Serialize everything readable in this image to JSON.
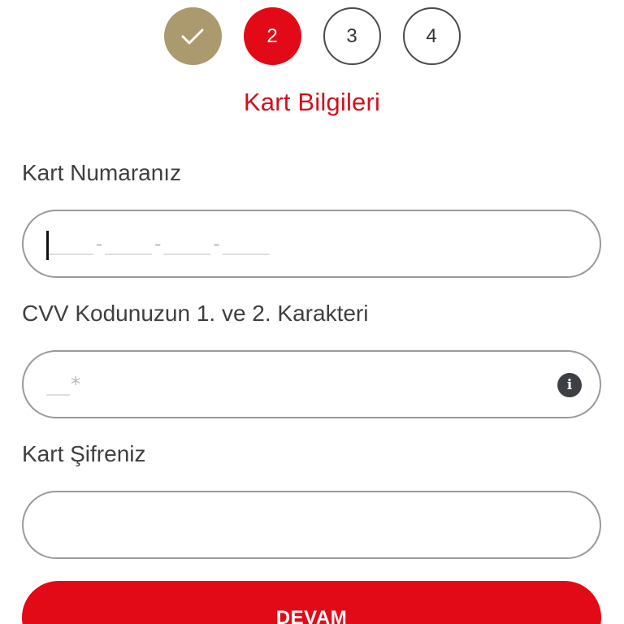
{
  "stepper": {
    "steps": [
      {
        "label": "",
        "state": "done",
        "icon": "check-icon"
      },
      {
        "label": "2",
        "state": "active"
      },
      {
        "label": "3",
        "state": "pending"
      },
      {
        "label": "4",
        "state": "pending"
      }
    ],
    "colors": {
      "done": "#aa9a6d",
      "active": "#e30a17"
    }
  },
  "form": {
    "title": "Kart Bilgileri",
    "card_number": {
      "label": "Kart Numaranız",
      "mask": "____-____-____-____"
    },
    "cvv": {
      "label": "CVV Kodunuzun 1. ve 2. Karakteri",
      "mask": "__*",
      "info_icon": "info-icon"
    },
    "pin": {
      "label": "Kart Şifreniz",
      "value": ""
    },
    "submit_label": "DEVAM"
  },
  "colors": {
    "accent": "#e30a17",
    "title": "#d0111c",
    "border": "#9a9a9a"
  }
}
